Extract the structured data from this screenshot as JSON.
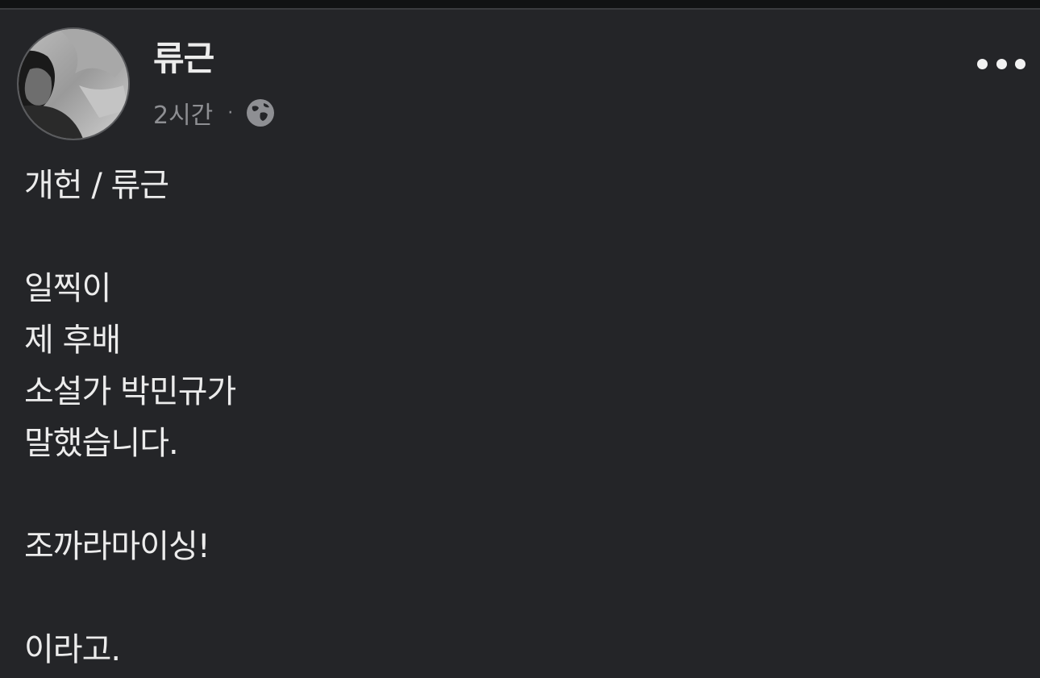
{
  "post": {
    "author": "류근",
    "timestamp": "2시간",
    "separator": "·",
    "privacy_icon": "globe-icon",
    "menu_icon": "more-horizontal-icon",
    "body_lines": [
      "개헌 / 류근",
      "",
      "일찍이",
      "제 후배",
      "소설가 박민규가",
      "말했습니다.",
      "",
      "조까라마이싱!",
      "",
      "이라고."
    ]
  }
}
